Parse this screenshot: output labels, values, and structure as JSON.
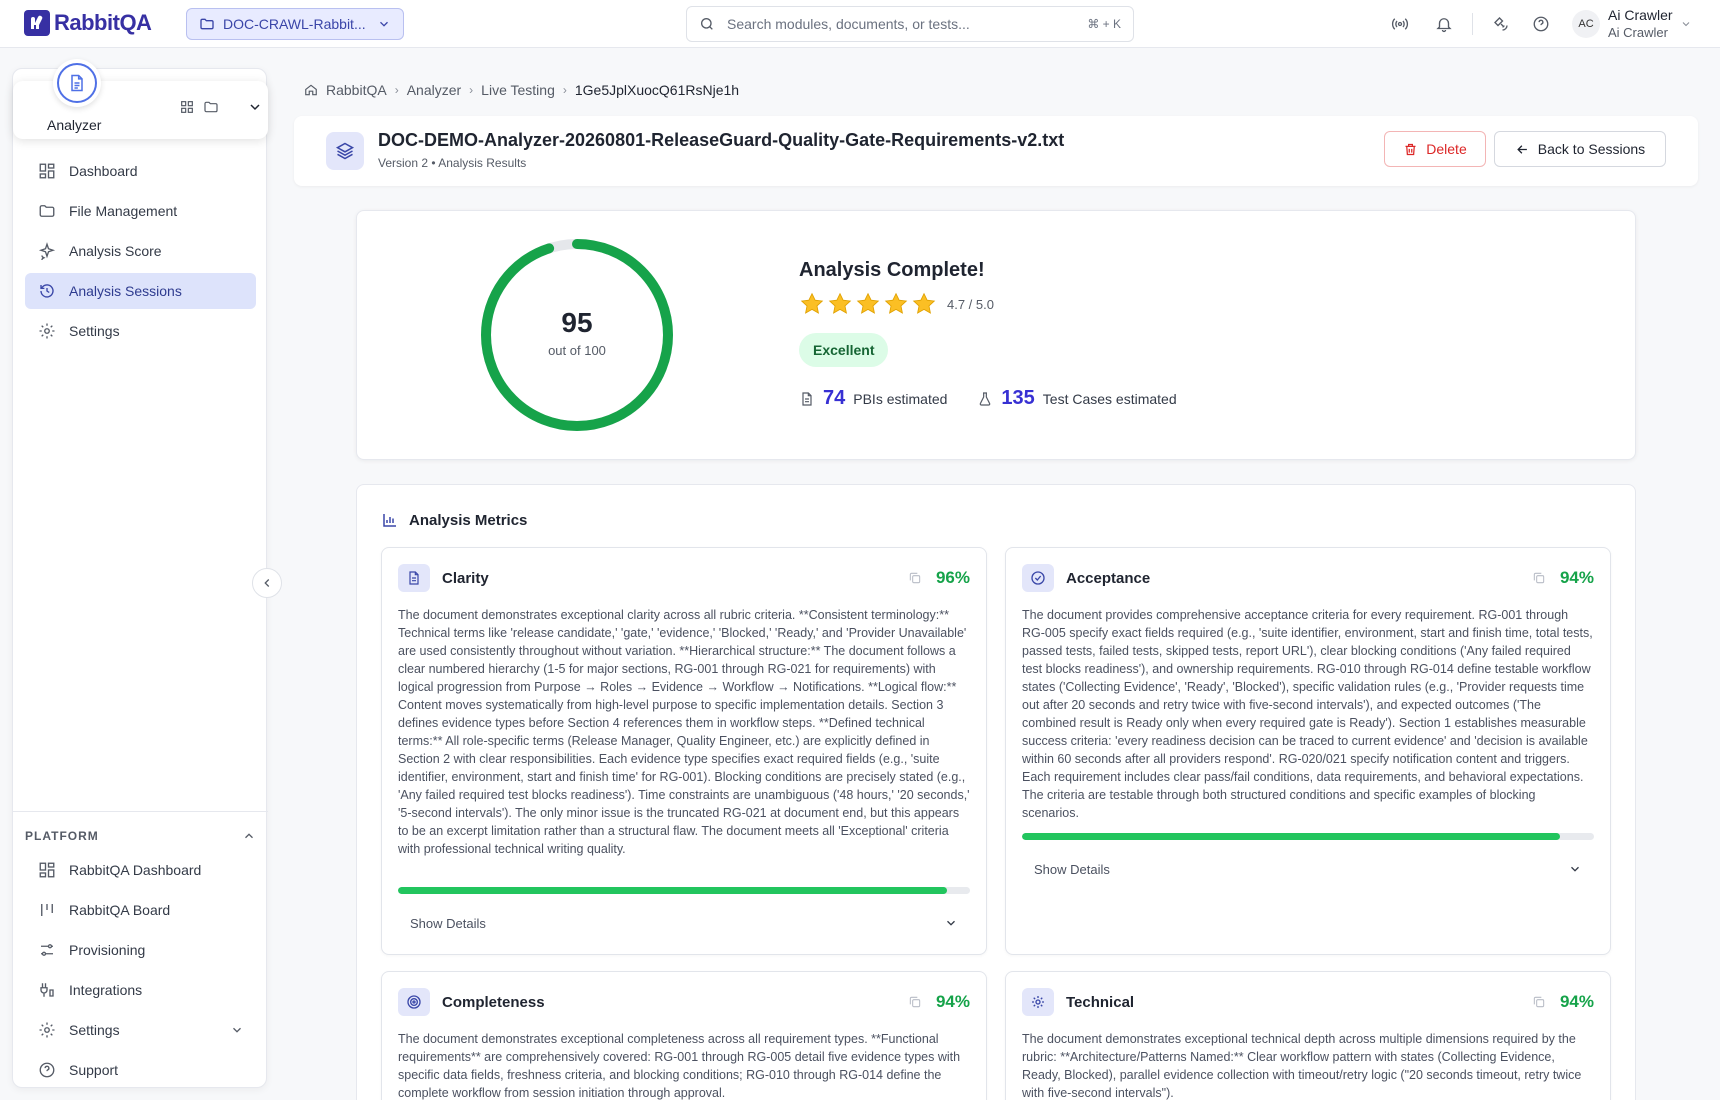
{
  "brand": {
    "name": "RabbitQA"
  },
  "project": {
    "label": "DOC-CRAWL-Rabbit..."
  },
  "search": {
    "placeholder": "Search modules, documents, or tests...",
    "shortcut": "⌘ + K"
  },
  "user": {
    "initials": "AC",
    "name": "Ai Crawler",
    "subtitle": "Ai Crawler"
  },
  "module": {
    "name": "Analyzer"
  },
  "nav": {
    "items": [
      {
        "label": "Dashboard",
        "icon": "dashboard-icon"
      },
      {
        "label": "File Management",
        "icon": "folder-icon"
      },
      {
        "label": "Analysis Score",
        "icon": "sparkle-icon"
      },
      {
        "label": "Analysis Sessions",
        "icon": "history-icon",
        "active": true
      },
      {
        "label": "Settings",
        "icon": "gear-icon"
      }
    ]
  },
  "platform": {
    "title": "PLATFORM",
    "items": [
      {
        "label": "RabbitQA Dashboard",
        "icon": "dashboard-icon"
      },
      {
        "label": "RabbitQA Board",
        "icon": "board-icon"
      },
      {
        "label": "Provisioning",
        "icon": "sliders-icon"
      },
      {
        "label": "Integrations",
        "icon": "integrations-icon"
      },
      {
        "label": "Settings",
        "icon": "gear-icon"
      },
      {
        "label": "Support",
        "icon": "help-icon"
      }
    ]
  },
  "breadcrumb": [
    "RabbitQA",
    "Analyzer",
    "Live Testing",
    "1Ge5JplXuocQ61RsNje1h"
  ],
  "document": {
    "title": "DOC-DEMO-Analyzer-20260801-ReleaseGuard-Quality-Gate-Requirements-v2.txt",
    "subtitle": "Version 2 • Analysis Results",
    "delete_label": "Delete",
    "back_label": "Back to Sessions"
  },
  "score": {
    "value": 95,
    "value_text": "95",
    "max_text": "out of 100",
    "title": "Analysis Complete!",
    "rating": 4.7,
    "rating_text": "4.7 / 5.0",
    "badge": "Excellent",
    "pbis": "74",
    "pbis_label": "PBIs estimated",
    "tests": "135",
    "tests_label": "Test Cases estimated",
    "colors": {
      "ring": "#16a34a",
      "track": "#e5e7eb",
      "star": "#fbbf24"
    }
  },
  "metrics": {
    "title": "Analysis Metrics",
    "show_details": "Show Details",
    "cards": [
      {
        "name": "Clarity",
        "icon": "document-icon",
        "percent": 96,
        "percent_text": "96%",
        "text": "The document demonstrates exceptional clarity across all rubric criteria. **Consistent terminology:** Technical terms like 'release candidate,' 'gate,' 'evidence,' 'Blocked,' 'Ready,' and 'Provider Unavailable' are used consistently throughout without variation. **Hierarchical structure:** The document follows a clear numbered hierarchy (1-5 for major sections, RG-001 through RG-021 for requirements) with logical progression from Purpose → Roles → Evidence → Workflow → Notifications. **Logical flow:** Content moves systematically from high-level purpose to specific implementation details. Section 3 defines evidence types before Section 4 references them in workflow steps. **Defined technical terms:** All role-specific terms (Release Manager, Quality Engineer, etc.) are explicitly defined in Section 2 with clear responsibilities. Each evidence type specifies exact required fields (e.g., 'suite identifier, environment, start and finish time' for RG-001). Blocking conditions are precisely stated (e.g., 'Any failed required test blocks readiness'). Time constraints are unambiguous ('48 hours,' '20 seconds,' '5-second intervals'). The only minor issue is the truncated RG-021 at document end, but this appears to be an excerpt limitation rather than a structural flaw. The document meets all 'Exceptional' criteria with professional technical writing quality."
      },
      {
        "name": "Acceptance",
        "icon": "check-circle-icon",
        "percent": 94,
        "percent_text": "94%",
        "text": "The document provides comprehensive acceptance criteria for every requirement. RG-001 through RG-005 specify exact fields required (e.g., 'suite identifier, environment, start and finish time, total tests, passed tests, failed tests, skipped tests, report URL'), clear blocking conditions ('Any failed required test blocks readiness'), and ownership requirements. RG-010 through RG-014 define testable workflow states ('Collecting Evidence', 'Ready', 'Blocked'), specific validation rules (e.g., 'Provider requests time out after 20 seconds and retry twice with five-second intervals'), and expected outcomes ('The combined result is Ready only when every required gate is Ready'). Section 1 establishes measurable success criteria: 'every readiness decision can be traced to current evidence' and 'decision is available within 60 seconds after all providers respond'. RG-020/021 specify notification content and triggers. Each requirement includes clear pass/fail conditions, data requirements, and behavioral expectations. The criteria are testable through both structured conditions and specific examples of blocking scenarios."
      },
      {
        "name": "Completeness",
        "icon": "target-icon",
        "percent": 94,
        "percent_text": "94%",
        "text": "The document demonstrates exceptional completeness across all requirement types. **Functional requirements** are comprehensively covered: RG-001 through RG-005 detail five evidence types with specific data fields, freshness criteria, and blocking conditions; RG-010 through RG-014 define the complete workflow from session initiation through approval."
      },
      {
        "name": "Technical",
        "icon": "cog-icon",
        "percent": 94,
        "percent_text": "94%",
        "text": "The document demonstrates exceptional technical depth across multiple dimensions required by the rubric: **Architecture/Patterns Named:** Clear workflow pattern with states (Collecting Evidence, Ready, Blocked), parallel evidence collection with timeout/retry logic (\"20 seconds timeout, retry twice with five-second intervals\")."
      }
    ]
  }
}
